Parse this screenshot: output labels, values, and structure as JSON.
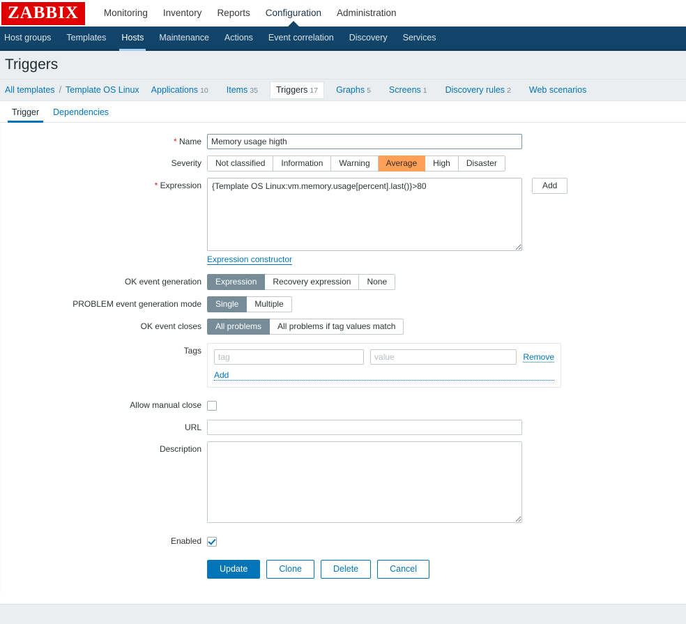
{
  "brand": {
    "logo_text": "ZABBIX"
  },
  "main_menu": {
    "items": [
      {
        "label": "Monitoring",
        "active": false
      },
      {
        "label": "Inventory",
        "active": false
      },
      {
        "label": "Reports",
        "active": false
      },
      {
        "label": "Configuration",
        "active": true
      },
      {
        "label": "Administration",
        "active": false
      }
    ]
  },
  "sub_menu": {
    "items": [
      {
        "label": "Host groups",
        "active": false
      },
      {
        "label": "Templates",
        "active": false
      },
      {
        "label": "Hosts",
        "active": true
      },
      {
        "label": "Maintenance",
        "active": false
      },
      {
        "label": "Actions",
        "active": false
      },
      {
        "label": "Event correlation",
        "active": false
      },
      {
        "label": "Discovery",
        "active": false
      },
      {
        "label": "Services",
        "active": false
      }
    ]
  },
  "header": {
    "title": "Triggers"
  },
  "breadcrumb": {
    "root_label": "All templates",
    "separator": "/",
    "template_label": "Template OS Linux",
    "tabs": [
      {
        "label": "Applications",
        "count": "10",
        "selected": false
      },
      {
        "label": "Items",
        "count": "35",
        "selected": false
      },
      {
        "label": "Triggers",
        "count": "17",
        "selected": true
      },
      {
        "label": "Graphs",
        "count": "5",
        "selected": false
      },
      {
        "label": "Screens",
        "count": "1",
        "selected": false
      },
      {
        "label": "Discovery rules",
        "count": "2",
        "selected": false
      },
      {
        "label": "Web scenarios",
        "count": "",
        "selected": false
      }
    ]
  },
  "form_tabs": [
    {
      "label": "Trigger",
      "active": true
    },
    {
      "label": "Dependencies",
      "active": false
    }
  ],
  "form": {
    "name": {
      "label": "Name",
      "required_marker": "*",
      "value": "Memory usage higth",
      "placeholder": ""
    },
    "severity": {
      "label": "Severity",
      "options": [
        {
          "label": "Not classified",
          "selected": false
        },
        {
          "label": "Information",
          "selected": false
        },
        {
          "label": "Warning",
          "selected": false
        },
        {
          "label": "Average",
          "selected": true
        },
        {
          "label": "High",
          "selected": false
        },
        {
          "label": "Disaster",
          "selected": false
        }
      ],
      "selected_color": "#ffa059"
    },
    "expression": {
      "label": "Expression",
      "required_marker": "*",
      "value": "{Template OS Linux:vm.memory.usage[percent].last()}>80",
      "add_button": "Add",
      "constructor_link": "Expression constructor"
    },
    "ok_event_generation": {
      "label": "OK event generation",
      "options": [
        {
          "label": "Expression",
          "selected": true
        },
        {
          "label": "Recovery expression",
          "selected": false
        },
        {
          "label": "None",
          "selected": false
        }
      ]
    },
    "problem_event_generation_mode": {
      "label": "PROBLEM event generation mode",
      "options": [
        {
          "label": "Single",
          "selected": true
        },
        {
          "label": "Multiple",
          "selected": false
        }
      ]
    },
    "ok_event_closes": {
      "label": "OK event closes",
      "options": [
        {
          "label": "All problems",
          "selected": true
        },
        {
          "label": "All problems if tag values match",
          "selected": false
        }
      ]
    },
    "tags": {
      "label": "Tags",
      "tag_placeholder": "tag",
      "tag_value": "",
      "value_placeholder": "value",
      "value_value": "",
      "remove_label": "Remove",
      "add_label": "Add"
    },
    "allow_manual_close": {
      "label": "Allow manual close",
      "checked": false
    },
    "url": {
      "label": "URL",
      "value": "",
      "placeholder": ""
    },
    "description": {
      "label": "Description",
      "value": "",
      "placeholder": ""
    },
    "enabled": {
      "label": "Enabled",
      "checked": true
    }
  },
  "actions": {
    "update": "Update",
    "clone": "Clone",
    "delete": "Delete",
    "cancel": "Cancel"
  },
  "colors": {
    "brand_red": "#e00000",
    "nav_blue": "#114468",
    "link_blue": "#0275b8",
    "selected_gray": "#768d99",
    "severity_average": "#ffa059"
  }
}
